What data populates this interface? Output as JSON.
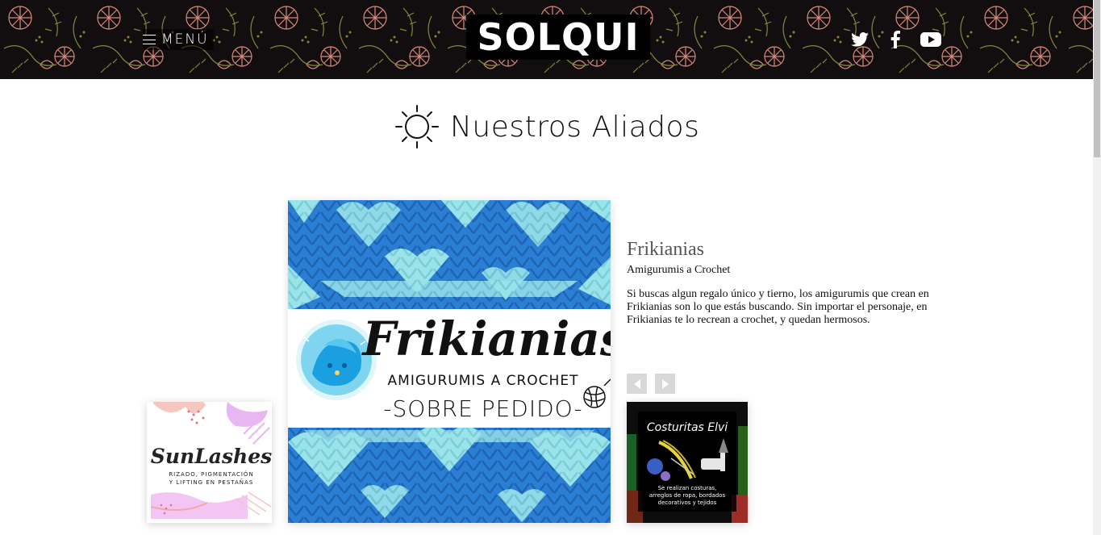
{
  "header": {
    "menu_label": "MENÚ",
    "logo_text": "SOLQUI",
    "social": [
      "twitter-icon",
      "facebook-icon",
      "youtube-icon"
    ],
    "colors": {
      "background": "#120d0e",
      "flower": "#d98a7a",
      "leaf": "#7d8a3c"
    }
  },
  "section": {
    "title": "Nuestros Aliados",
    "icon": "sun-icon"
  },
  "featured": {
    "name": "Frikianias",
    "subtitle": "Amigurumis a Crochet",
    "description": "Si buscas algun regalo único y tierno, los amigurumis que crean en Frikianias son lo que estás buscando. Sin importar el personaje, en Frikianias te lo recrean a crochet, y quedan hermosos.",
    "logo": {
      "brand": "Frikianias",
      "line1": "AMIGURUMIS A CROCHET",
      "line2": "-SOBRE PEDIDO-"
    }
  },
  "carousel": {
    "prev": "prev-arrow-icon",
    "next": "next-arrow-icon"
  },
  "cards": {
    "left": {
      "brand": "SunLashes",
      "tagline1": "RIZADO, PIGMENTACIÓN",
      "tagline2": "Y LIFTING EN PESTAÑAS"
    },
    "right": {
      "brand": "Costuritas Elvi",
      "text1": "Se realizan costuras,",
      "text2": "arreglos de ropa, bordados",
      "text3": "decorativos y tejidos"
    }
  },
  "colors": {
    "knit_dark": "#2a7fd4",
    "knit_light": "#9ae3ea",
    "accent_text": "#111111"
  }
}
